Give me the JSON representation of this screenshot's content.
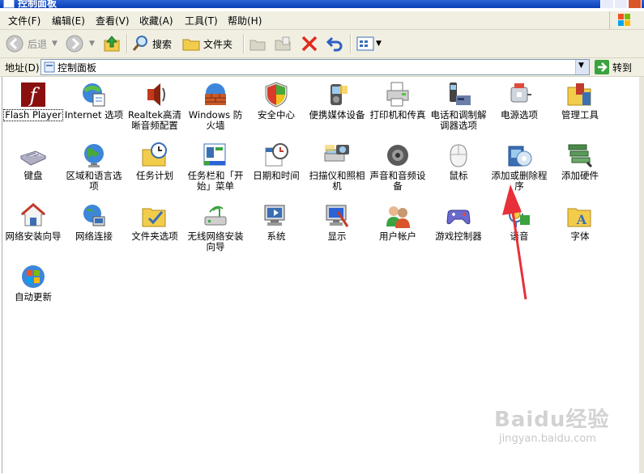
{
  "window": {
    "title": "控制面板"
  },
  "menu": [
    "文件(F)",
    "编辑(E)",
    "查看(V)",
    "收藏(A)",
    "工具(T)",
    "帮助(H)"
  ],
  "toolbar": {
    "back": "后退",
    "search": "搜索",
    "folders": "文件夹"
  },
  "address": {
    "label": "地址(D)",
    "value": "控制面板",
    "go": "转到"
  },
  "items": [
    {
      "label": "Flash Player",
      "icon": "flash-icon"
    },
    {
      "label": "Internet 选项",
      "icon": "internet-options-icon"
    },
    {
      "label": "Realtek高清晰音频配置",
      "icon": "speaker-icon"
    },
    {
      "label": "Windows 防火墙",
      "icon": "firewall-icon"
    },
    {
      "label": "安全中心",
      "icon": "shield-icon"
    },
    {
      "label": "便携媒体设备",
      "icon": "media-device-icon"
    },
    {
      "label": "打印机和传真",
      "icon": "printer-icon"
    },
    {
      "label": "电话和调制解调器选项",
      "icon": "phone-icon"
    },
    {
      "label": "电源选项",
      "icon": "power-icon"
    },
    {
      "label": "管理工具",
      "icon": "admin-tools-icon"
    },
    {
      "label": "键盘",
      "icon": "keyboard-icon"
    },
    {
      "label": "区域和语言选项",
      "icon": "globe-icon"
    },
    {
      "label": "任务计划",
      "icon": "scheduled-tasks-icon"
    },
    {
      "label": "任务栏和「开始」菜单",
      "icon": "taskbar-icon"
    },
    {
      "label": "日期和时间",
      "icon": "clock-icon"
    },
    {
      "label": "扫描仪和照相机",
      "icon": "scanner-icon"
    },
    {
      "label": "声音和音频设备",
      "icon": "sound-icon"
    },
    {
      "label": "鼠标",
      "icon": "mouse-icon"
    },
    {
      "label": "添加或删除程序",
      "icon": "add-remove-programs-icon"
    },
    {
      "label": "添加硬件",
      "icon": "add-hardware-icon"
    },
    {
      "label": "网络安装向导",
      "icon": "home-network-icon"
    },
    {
      "label": "网络连接",
      "icon": "network-connections-icon"
    },
    {
      "label": "文件夹选项",
      "icon": "folder-options-icon"
    },
    {
      "label": "无线网络安装向导",
      "icon": "wireless-icon"
    },
    {
      "label": "系统",
      "icon": "system-icon"
    },
    {
      "label": "显示",
      "icon": "display-icon"
    },
    {
      "label": "用户帐户",
      "icon": "user-accounts-icon"
    },
    {
      "label": "游戏控制器",
      "icon": "gamepad-icon"
    },
    {
      "label": "语音",
      "icon": "speech-icon"
    },
    {
      "label": "字体",
      "icon": "fonts-icon"
    },
    {
      "label": "自动更新",
      "icon": "windows-update-icon"
    }
  ],
  "watermark": {
    "main": "Baidu经验",
    "sub": "jingyan.baidu.com"
  },
  "colors": {
    "titlebar": "#0a3fb5",
    "toolbar": "#f1efe2",
    "arrow": "#e8303a"
  }
}
